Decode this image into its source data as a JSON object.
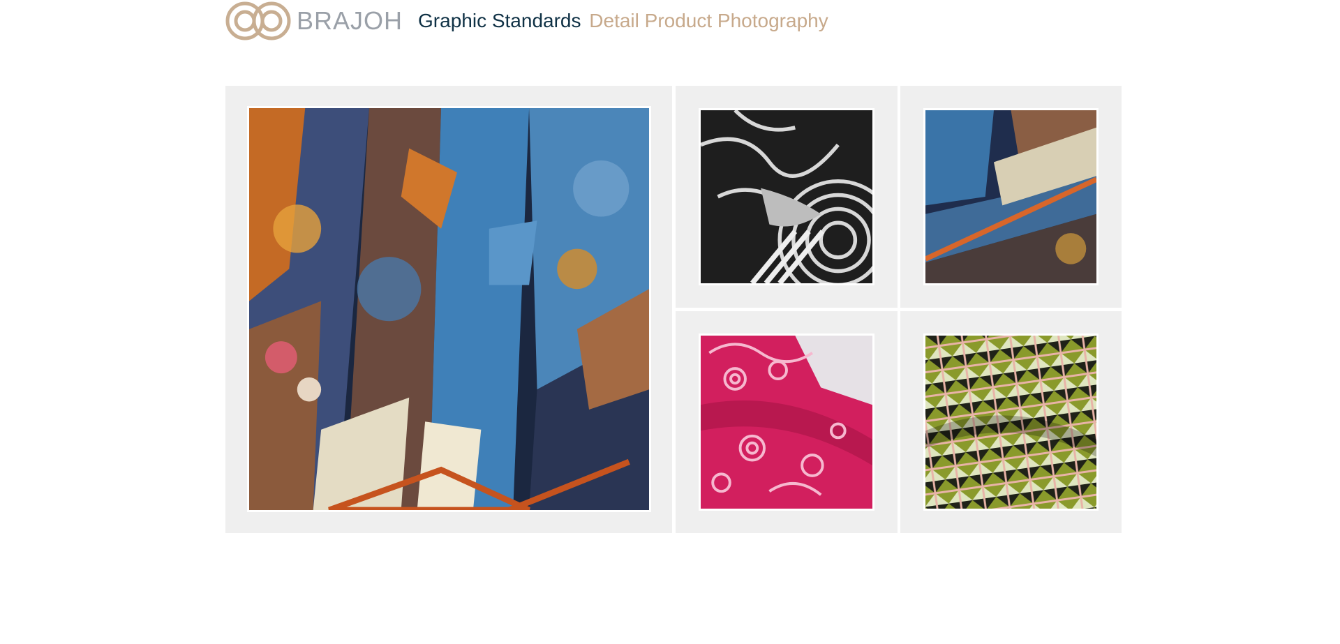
{
  "header": {
    "logo_text": "BRAJOH",
    "title_primary": "Graphic Standards",
    "title_secondary": "Detail Product Photography"
  },
  "colors": {
    "title_primary": "#0f3145",
    "title_secondary": "#c7a98b",
    "logo_mark": "#c8ae92",
    "logo_word": "#9aa0a8",
    "panel_background": "#efefef"
  },
  "gallery": {
    "photos": [
      {
        "subject": "multicolor silk scarf close-up (blue, orange, navy print)"
      },
      {
        "subject": "black and white patterned silk scarf"
      },
      {
        "subject": "blue and beige scarf with orange rolled hem"
      },
      {
        "subject": "pink swirl patterned silk scarf"
      },
      {
        "subject": "olive green geometric patterned silk scarf"
      }
    ]
  }
}
